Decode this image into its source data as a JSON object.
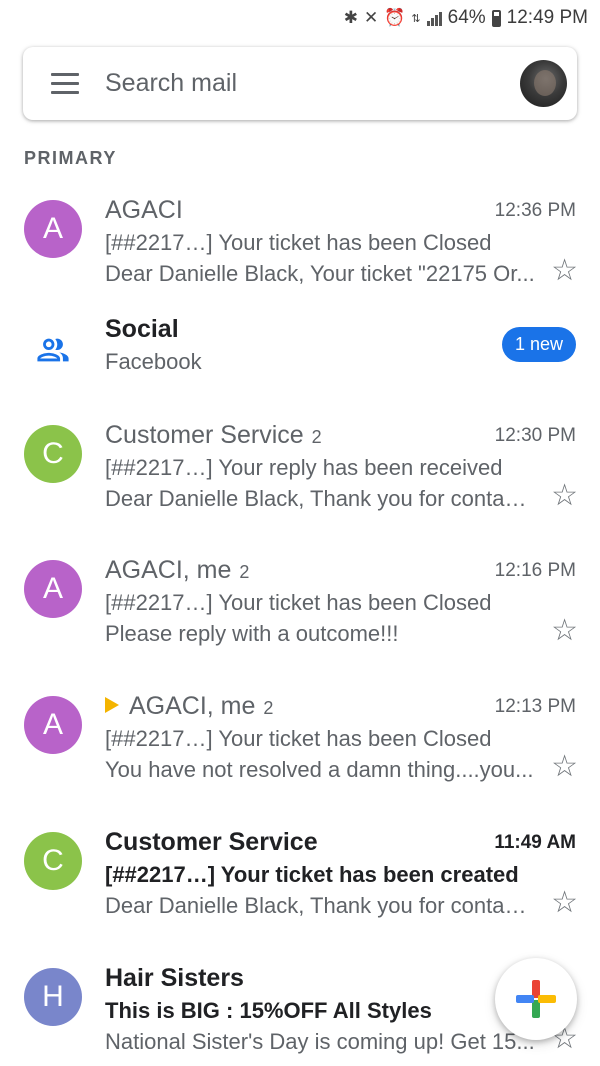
{
  "status_bar": {
    "battery": "64%",
    "time": "12:49 PM",
    "icons": [
      "bluetooth-icon",
      "vibrate-mute-icon",
      "alarm-icon",
      "data-icon",
      "signal-icon",
      "battery-icon"
    ]
  },
  "search": {
    "placeholder": "Search mail"
  },
  "section_label": "PRIMARY",
  "colors": {
    "avatar_purple": "#b863c9",
    "avatar_green": "#8bc34a",
    "avatar_indigo": "#7986cb",
    "badge_blue": "#1a73e8",
    "important_yellow": "#f4b400"
  },
  "emails": [
    {
      "initial": "A",
      "sender": "AGACI",
      "count": "",
      "time": "12:36 PM",
      "subject": "[##2217…] Your ticket has been Closed",
      "snippet": "Dear Danielle Black, Your ticket \"22175 Or...",
      "unread": false,
      "important": false
    },
    {
      "initial": "C",
      "sender": "Customer Service",
      "count": "2",
      "time": "12:30 PM",
      "subject": "[##2217…] Your reply has been received",
      "snippet": "Dear Danielle Black, Thank you for contact...",
      "unread": false,
      "important": false
    },
    {
      "initial": "A",
      "sender": "AGACI, me",
      "count": "2",
      "time": "12:16 PM",
      "subject": "[##2217…] Your ticket has been Closed",
      "snippet": "Please reply with a outcome!!!",
      "unread": false,
      "important": false
    },
    {
      "initial": "A",
      "sender": "AGACI, me",
      "count": "2",
      "time": "12:13 PM",
      "subject": "[##2217…] Your ticket has been Closed",
      "snippet": "You have not resolved a damn thing....you...",
      "unread": false,
      "important": true
    },
    {
      "initial": "C",
      "sender": "Customer Service",
      "count": "",
      "time": "11:49 AM",
      "subject": "[##2217…] Your ticket has been created",
      "snippet": "Dear Danielle Black, Thank you for contact...",
      "unread": true,
      "important": false
    },
    {
      "initial": "H",
      "sender": "Hair Sisters",
      "count": "",
      "time": "",
      "subject": "This is BIG : 15%OFF All Styles",
      "snippet": "National Sister's Day is coming up! Get 15...",
      "unread": true,
      "important": false
    }
  ],
  "social": {
    "title": "Social",
    "subtitle": "Facebook",
    "badge": "1 new"
  }
}
